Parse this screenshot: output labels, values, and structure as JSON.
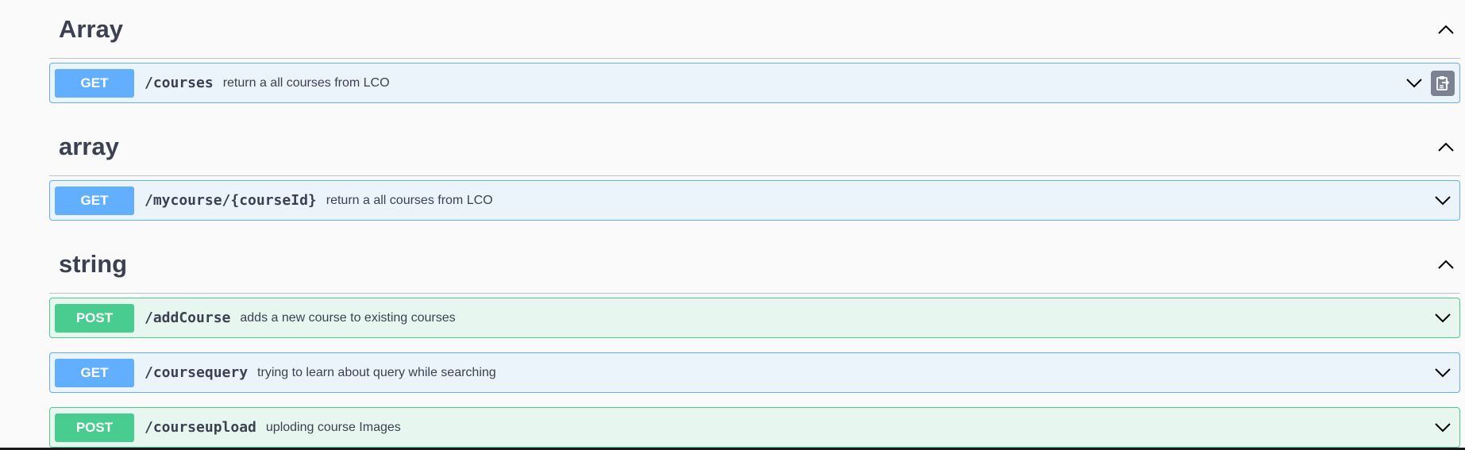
{
  "colors": {
    "get_accent": "#61affe",
    "get_bg": "#ebf3fb",
    "post_accent": "#49cc90",
    "post_bg": "#e8f6f0",
    "text": "#3b4151"
  },
  "groups": [
    {
      "title": "Array",
      "operations": [
        {
          "method": "GET",
          "path": "/courses",
          "summary": "return a all courses from LCO"
        }
      ]
    },
    {
      "title": "array",
      "operations": [
        {
          "method": "GET",
          "path": "/mycourse/{courseId}",
          "summary": "return a all courses from LCO"
        }
      ]
    },
    {
      "title": "string",
      "operations": [
        {
          "method": "POST",
          "path": "/addCourse",
          "summary": "adds a new course to existing courses"
        },
        {
          "method": "GET",
          "path": "/coursequery",
          "summary": "trying to learn about query while searching"
        },
        {
          "method": "POST",
          "path": "/courseupload",
          "summary": "uploding course Images"
        }
      ]
    }
  ]
}
